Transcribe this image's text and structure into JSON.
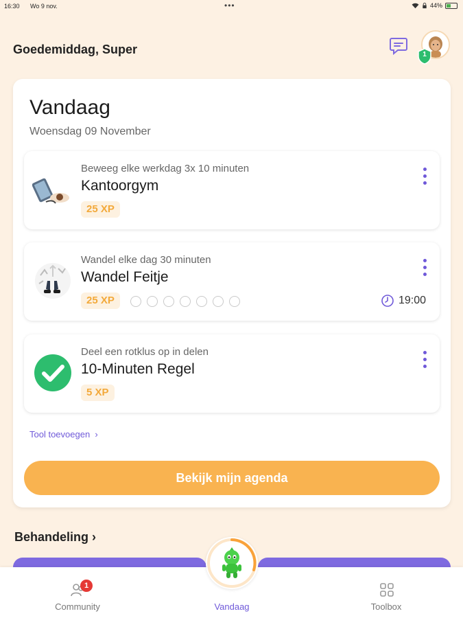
{
  "status_bar": {
    "time": "16:30",
    "date": "Wo 9 nov.",
    "dots": "•••",
    "battery": "44%",
    "battery_level": 0.44
  },
  "header": {
    "greeting": "Goedemiddag, Super",
    "level_badge": "1"
  },
  "today": {
    "title": "Vandaag",
    "date": "Woensdag 09 November",
    "tasks": [
      {
        "subtitle": "Beweeg elke werkdag 3x 10 minuten",
        "name": "Kantoorgym",
        "xp": "25 XP"
      },
      {
        "subtitle": "Wandel elke dag 30 minuten",
        "name": "Wandel Feitje",
        "xp": "25 XP",
        "reminder_time": "19:00",
        "progress_total": 7,
        "progress_done": 0
      },
      {
        "subtitle": "Deel een rotklus op in delen",
        "name": "10-Minuten Regel",
        "xp": "5 XP"
      }
    ],
    "add_tool": "Tool toevoegen",
    "agenda_button": "Bekijk mijn agenda"
  },
  "section": {
    "behandeling": "Behandeling"
  },
  "bottom_nav": {
    "community": "Community",
    "community_badge": "1",
    "vandaag": "Vandaag",
    "toolbox": "Toolbox"
  },
  "colors": {
    "accent": "#6f59d9",
    "orange": "#f9b350",
    "xp_text": "#f3a93a",
    "background": "#fdf1e3",
    "success": "#2dbd6e"
  }
}
